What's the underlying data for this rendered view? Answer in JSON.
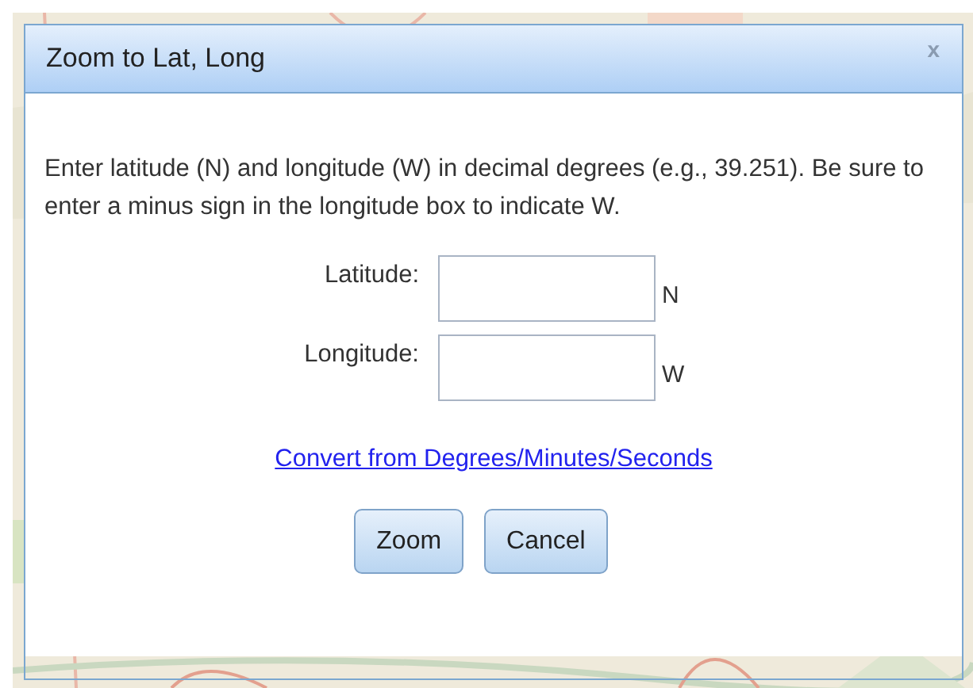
{
  "dialog": {
    "title": "Zoom to Lat, Long",
    "close": "x",
    "instructions": "Enter latitude (N) and longitude (W) in decimal degrees (e.g., 39.251). Be sure to enter a minus sign in the longitude box to indicate W.",
    "fields": [
      {
        "label": "Latitude:",
        "unit": "N"
      },
      {
        "label": "Longitude:",
        "unit": "W"
      }
    ],
    "link": "Convert from Degrees/Minutes/Seconds",
    "buttons": [
      "Zoom",
      "Cancel"
    ]
  }
}
